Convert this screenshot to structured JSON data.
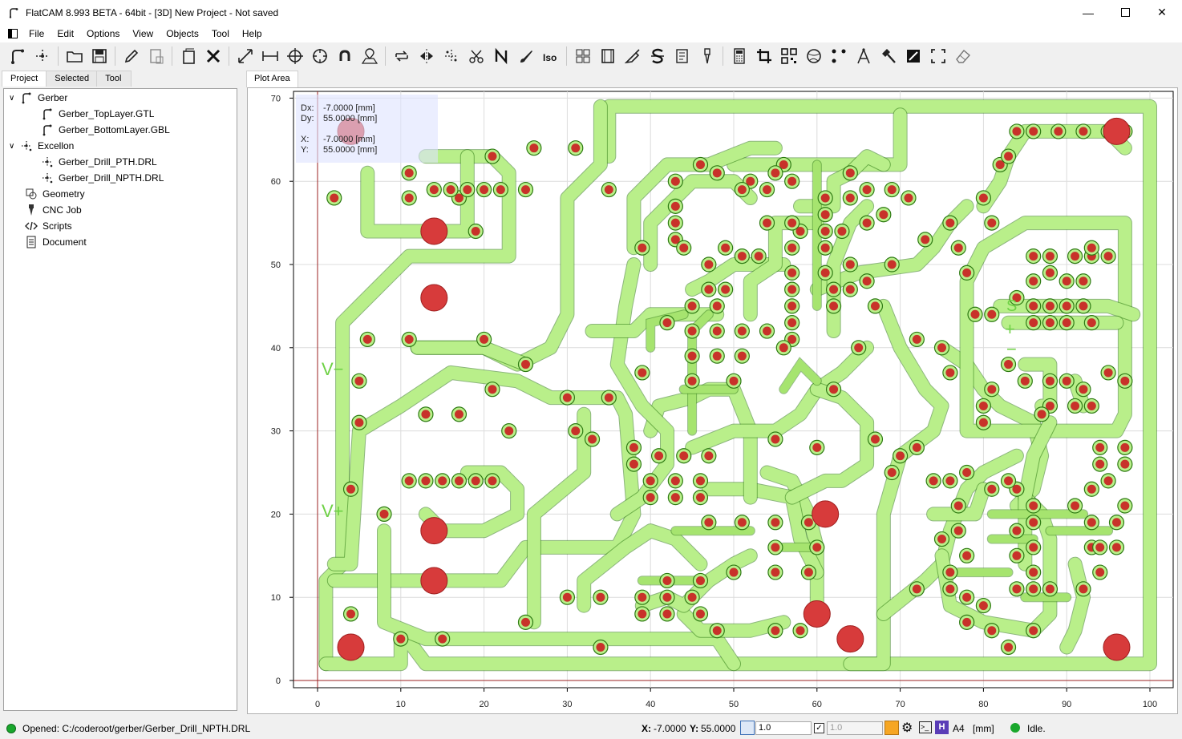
{
  "window": {
    "title": "FlatCAM 8.993 BETA - 64bit - [3D]    New Project - Not saved",
    "minimize_icon": "minimize-icon",
    "maximize_icon": "maximize-icon",
    "close_icon": "close-icon"
  },
  "menu": [
    "File",
    "Edit",
    "Options",
    "View",
    "Objects",
    "Tool",
    "Help"
  ],
  "left_tabs": [
    "Project",
    "Selected",
    "Tool"
  ],
  "tree": {
    "gerber": "Gerber",
    "gerber_items": [
      "Gerber_TopLayer.GTL",
      "Gerber_BottomLayer.GBL"
    ],
    "excellon": "Excellon",
    "excellon_items": [
      "Gerber_Drill_PTH.DRL",
      "Gerber_Drill_NPTH.DRL"
    ],
    "geometry": "Geometry",
    "cnc": "CNC Job",
    "scripts": "Scripts",
    "document": "Document"
  },
  "plot_tab": "Plot Area",
  "readout": {
    "dx_label": "Dx:",
    "dx": "-7.0000 [mm]",
    "dy_label": "Dy:",
    "dy": "55.0000 [mm]",
    "x_label": "X:",
    "x": "-7.0000 [mm]",
    "y_label": "Y:",
    "y": "55.0000 [mm]"
  },
  "axes": {
    "x_ticks": [
      "0",
      "10",
      "20",
      "30",
      "40",
      "50",
      "60",
      "70",
      "80",
      "90",
      "100"
    ],
    "y_ticks": [
      "0",
      "10",
      "20",
      "30",
      "40",
      "50",
      "60",
      "70"
    ]
  },
  "silk": {
    "v_minus": "V−",
    "v_plus": "V+",
    "s": "S",
    "plus": "+",
    "minus": "−"
  },
  "status": {
    "message": "Opened: C:/coderoot/gerber/Gerber_Drill_NPTH.DRL",
    "x_label": "X:",
    "x_value": "-7.0000",
    "y_label": "Y:",
    "y_value": "55.0000",
    "grid_x": "1.0",
    "grid_y": "1.0",
    "paper": "A4",
    "units": "[mm]",
    "state": "Idle.",
    "h_label": "H"
  },
  "colors": {
    "copper": "#b9ef8a",
    "outline": "#2d7a12",
    "pad": "#c8322a",
    "hole": "#d73b3b"
  }
}
